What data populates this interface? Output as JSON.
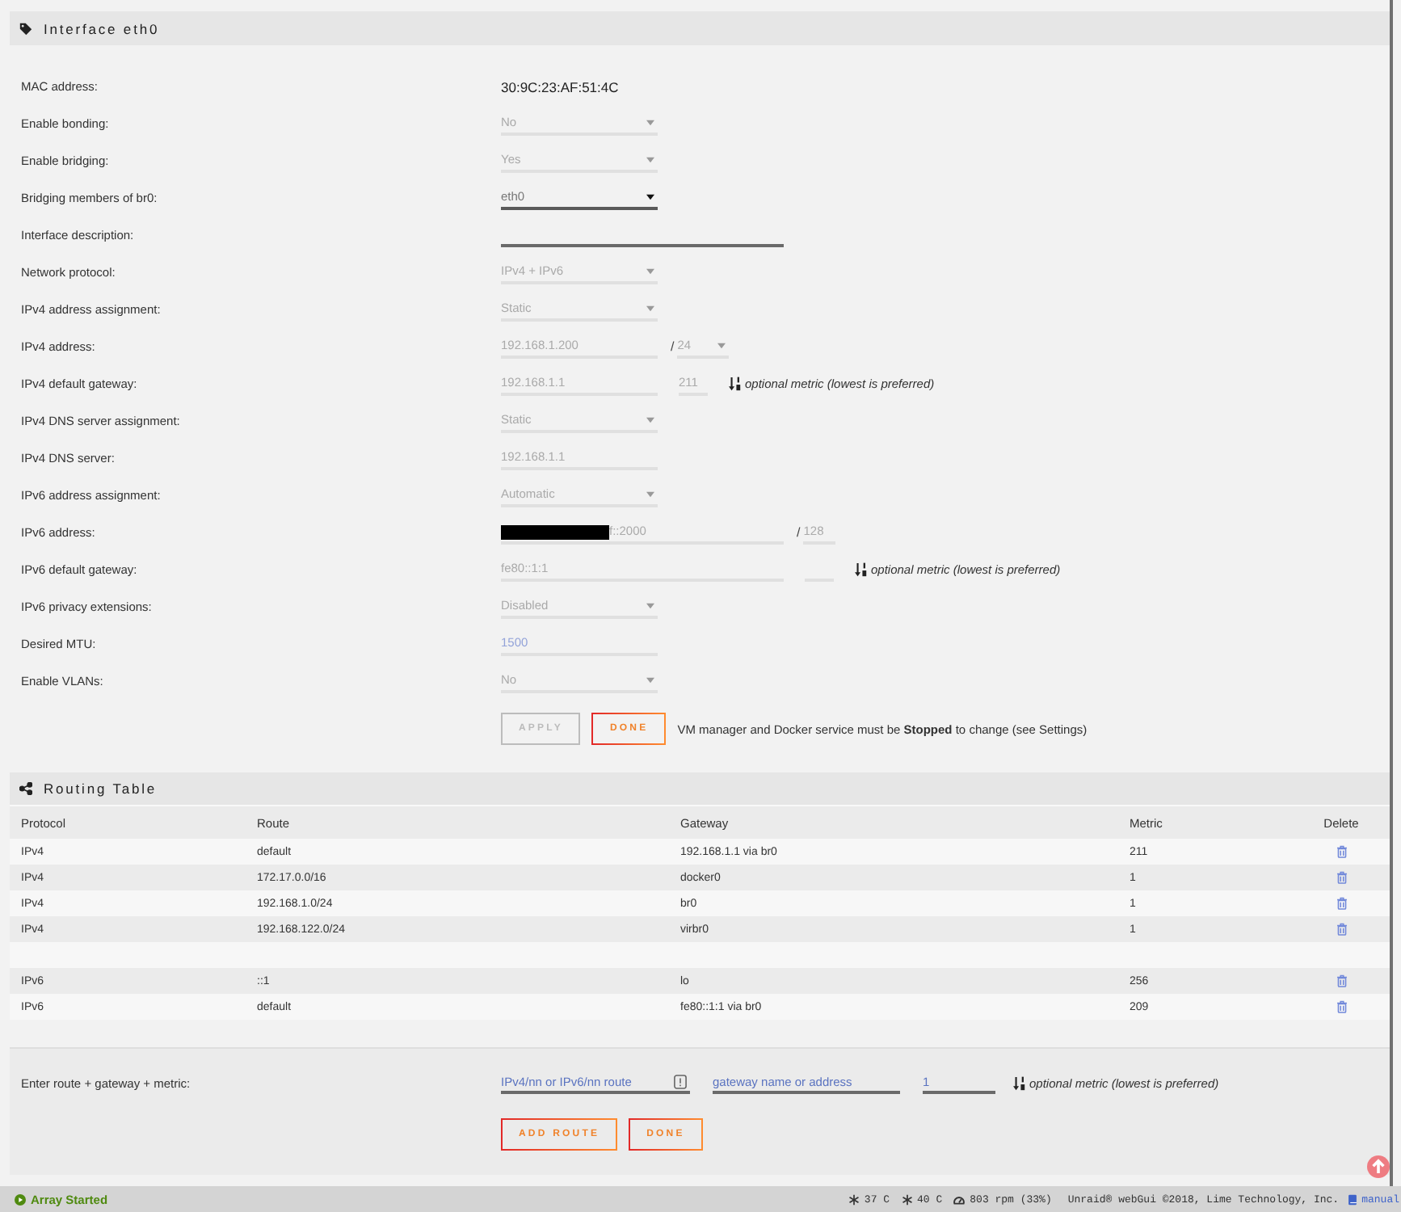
{
  "interface_panel": {
    "title": "Interface eth0",
    "fields": [
      {
        "kind": "static",
        "label": "MAC address:",
        "value": "30:9C:23:AF:51:4C"
      },
      {
        "kind": "select",
        "label": "Enable bonding:",
        "value": "No",
        "disabled": true
      },
      {
        "kind": "select",
        "label": "Enable bridging:",
        "value": "Yes",
        "disabled": true
      },
      {
        "kind": "select",
        "label": "Bridging members of br0:",
        "value": "eth0",
        "disabled": false
      },
      {
        "kind": "longinput",
        "label": "Interface description:",
        "disabled": false
      },
      {
        "kind": "select",
        "label": "Network protocol:",
        "value": "IPv4 + IPv6",
        "disabled": true
      },
      {
        "kind": "select",
        "label": "IPv4 address assignment:",
        "value": "Static",
        "disabled": true
      },
      {
        "kind": "input",
        "label": "IPv4 address:",
        "value": "192.168.1.200",
        "disabled": true,
        "prefix": {
          "kind": "select",
          "separator": "/",
          "value": "24",
          "disabled": true
        }
      },
      {
        "kind": "input",
        "label": "IPv4 default gateway:",
        "value": "192.168.1.1",
        "disabled": true,
        "metric": {
          "value": "211",
          "disabled": true
        },
        "hint": "optional metric (lowest is preferred)"
      },
      {
        "kind": "select",
        "label": "IPv4 DNS server assignment:",
        "value": "Static",
        "disabled": true
      },
      {
        "kind": "input",
        "label": "IPv4 DNS server:",
        "value": "192.168.1.1",
        "disabled": true
      },
      {
        "kind": "select",
        "label": "IPv6 address assignment:",
        "value": "Automatic",
        "disabled": true
      },
      {
        "kind": "longinput",
        "label": "IPv6 address:",
        "value": "f::2000",
        "redacted": true,
        "disabled": true,
        "prefix": {
          "kind": "input",
          "separator": "/",
          "value": "128",
          "disabled": true
        }
      },
      {
        "kind": "longinput",
        "label": "IPv6 default gateway:",
        "value": "fe80::1:1",
        "disabled": true,
        "metric": {
          "disabled": true
        },
        "hint": "optional metric (lowest is preferred)"
      },
      {
        "kind": "select",
        "label": "IPv6 privacy extensions:",
        "value": "Disabled",
        "disabled": true
      },
      {
        "kind": "input",
        "label": "Desired MTU:",
        "placeholder": "1500",
        "disabled": true
      },
      {
        "kind": "select",
        "label": "Enable VLANs:",
        "value": "No",
        "disabled": true
      }
    ],
    "buttons": [
      {
        "label": "APPLY",
        "disabled": true
      },
      {
        "label": "DONE",
        "disabled": false
      }
    ],
    "note": "VM manager and Docker service must be **Stopped** to change (see Settings)"
  },
  "routing_table": {
    "title": "Routing Table",
    "columns": [
      "Protocol",
      "Route",
      "Gateway",
      "Metric",
      "Delete"
    ],
    "rows": [
      {
        "kind": "route",
        "protocol": "IPv4",
        "route": "default",
        "gateway": "192.168.1.1 via br0",
        "metric": "211"
      },
      {
        "kind": "route",
        "protocol": "IPv4",
        "route": "172.17.0.0/16",
        "gateway": "docker0",
        "metric": "1"
      },
      {
        "kind": "route",
        "protocol": "IPv4",
        "route": "192.168.1.0/24",
        "gateway": "br0",
        "metric": "1"
      },
      {
        "kind": "route",
        "protocol": "IPv4",
        "route": "192.168.122.0/24",
        "gateway": "virbr0",
        "metric": "1"
      },
      {
        "kind": "blank"
      },
      {
        "kind": "route",
        "protocol": "IPv6",
        "route": "::1",
        "gateway": "lo",
        "metric": "256"
      },
      {
        "kind": "route",
        "protocol": "IPv6",
        "route": "default",
        "gateway": "fe80::1:1 via br0",
        "metric": "209"
      }
    ]
  },
  "add_route": {
    "label": "Enter route + gateway + metric:",
    "route_field": {
      "placeholder": "IPv4/nn or IPv6/nn route"
    },
    "gateway_field": {
      "placeholder": "gateway name or address"
    },
    "metric_field": {
      "placeholder": "1"
    },
    "hint": "optional metric (lowest is preferred)",
    "buttons": [
      {
        "label": "ADD ROUTE",
        "disabled": false
      },
      {
        "label": "DONE",
        "disabled": false
      }
    ]
  },
  "status_bar": {
    "array_status": "Array Started",
    "readings": [
      {
        "kind": "temperature",
        "text": "37 C"
      },
      {
        "kind": "temperature",
        "text": "40 C"
      },
      {
        "kind": "fan",
        "text": "803 rpm (33%)"
      }
    ],
    "credit": "Unraid® webGui ©2018, Lime Technology, Inc.",
    "manual_link": "manual"
  }
}
